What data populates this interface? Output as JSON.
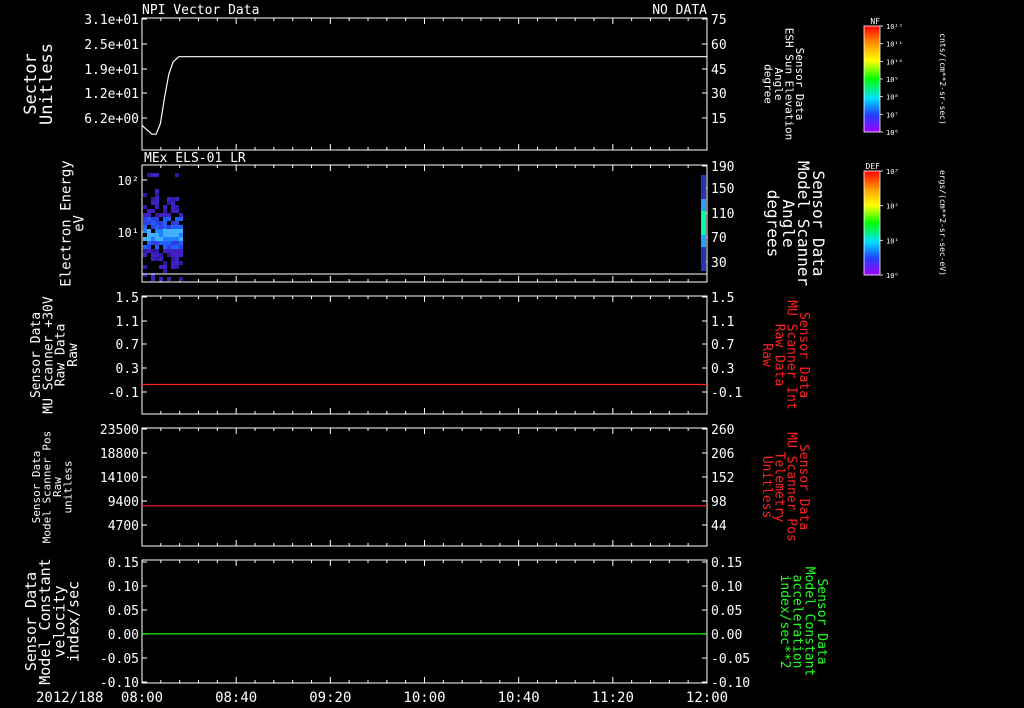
{
  "colors": {
    "background": "#000000",
    "axis": "#ffffff",
    "red": "#ff2020",
    "green": "#20ff20"
  },
  "header": {
    "left_title": "NPI Vector Data",
    "right_status": "NO DATA"
  },
  "x_axis": {
    "date": "2012/188",
    "ticks": [
      "08:00",
      "08:40",
      "09:20",
      "10:00",
      "10:40",
      "11:20",
      "12:00"
    ]
  },
  "chart_data": [
    {
      "type": "line",
      "left_label_lines": [
        "Sector",
        "Unitless"
      ],
      "left_ticks": [
        "3.1e+01",
        "2.5e+01",
        "1.9e+01",
        "1.2e+01",
        "6.2e+00"
      ],
      "right_label_lines": [
        "Sensor Data",
        "ESH Sun Elevation",
        "Angle",
        "degree"
      ],
      "right_ticks": [
        "75",
        "60",
        "45",
        "30",
        "15"
      ],
      "right_ylim": [
        0,
        75
      ],
      "series": [
        {
          "color": "white",
          "x": [
            0,
            0.02,
            0.035,
            0.05,
            0.065,
            0.08,
            0.095,
            0.11,
            0.13,
            2.0
          ],
          "y": [
            14,
            11,
            9,
            9,
            15,
            30,
            43,
            50,
            53,
            53
          ]
        }
      ]
    },
    {
      "type": "heatmap",
      "title": "MEx ELS-01 LR",
      "left_label_lines": [
        "Electron Energy",
        "eV"
      ],
      "left_ticks": [
        "10²",
        "10¹"
      ],
      "right_label_lines": [
        "Sensor Data",
        "Model Scanner",
        "Angle",
        "degrees"
      ],
      "right_ticks": [
        "190",
        "150",
        "110",
        "70",
        "30"
      ],
      "data_x_extent": [
        0,
        0.14
      ],
      "baseline": "white"
    },
    {
      "type": "line",
      "left_label_lines": [
        "Sensor Data",
        "MU Scanner +30V",
        "Raw Data",
        "Raw"
      ],
      "left_ticks": [
        "1.5",
        "1.1",
        "0.7",
        "0.3",
        "-0.1"
      ],
      "right_label_lines": [
        "Sensor Data",
        "MU Scanner Int",
        "Raw Data",
        "Raw"
      ],
      "right_ticks": [
        "1.5",
        "1.1",
        "0.7",
        "0.3",
        "-0.1"
      ],
      "ylim": [
        -0.5,
        1.5
      ],
      "series": [
        {
          "color": "red",
          "x": [
            0,
            2.0
          ],
          "y": [
            0,
            0
          ]
        }
      ]
    },
    {
      "type": "line",
      "left_label_lines": [
        "Sensor Data",
        "Model Scanner Pos",
        "Raw",
        "unitless"
      ],
      "left_ticks": [
        "23500",
        "18800",
        "14100",
        "9400",
        "4700"
      ],
      "right_label_lines": [
        "Sensor Data",
        "MU Scanner Pos",
        "Telemetry",
        "Unitless"
      ],
      "right_ticks": [
        "260",
        "206",
        "152",
        "98",
        "44"
      ],
      "ylim": [
        0,
        23500
      ],
      "series": [
        {
          "color": "red",
          "x": [
            0,
            2.0
          ],
          "y": [
            8000,
            8000
          ]
        }
      ]
    },
    {
      "type": "line",
      "left_label_lines": [
        "Sensor Data",
        "Model Constant",
        "velocity",
        "index/sec"
      ],
      "left_ticks": [
        "0.15",
        "0.10",
        "0.05",
        "0.00",
        "-0.05",
        "-0.10"
      ],
      "right_label_lines": [
        "Sensor Data",
        "Model Constant",
        "acceleration",
        "index/sec**2"
      ],
      "right_ticks": [
        "0.15",
        "0.10",
        "0.05",
        "0.00",
        "-0.05",
        "-0.10"
      ],
      "ylim": [
        -0.1,
        0.15
      ],
      "series": [
        {
          "color": "green",
          "x": [
            0,
            2.0
          ],
          "y": [
            0,
            0
          ]
        }
      ]
    }
  ],
  "colorbars": [
    {
      "label": "NF",
      "unit": "cnts/(cm**2-sr-sec)",
      "ticks": [
        "10¹²",
        "10¹¹",
        "10¹⁰",
        "10⁹",
        "10⁸",
        "10⁷",
        "10⁶"
      ]
    },
    {
      "label": "DEF",
      "unit": "ergs/(cm**2-sr-sec-eV)",
      "ticks": [
        "10³",
        "10²",
        "10¹",
        "10⁰"
      ]
    }
  ]
}
